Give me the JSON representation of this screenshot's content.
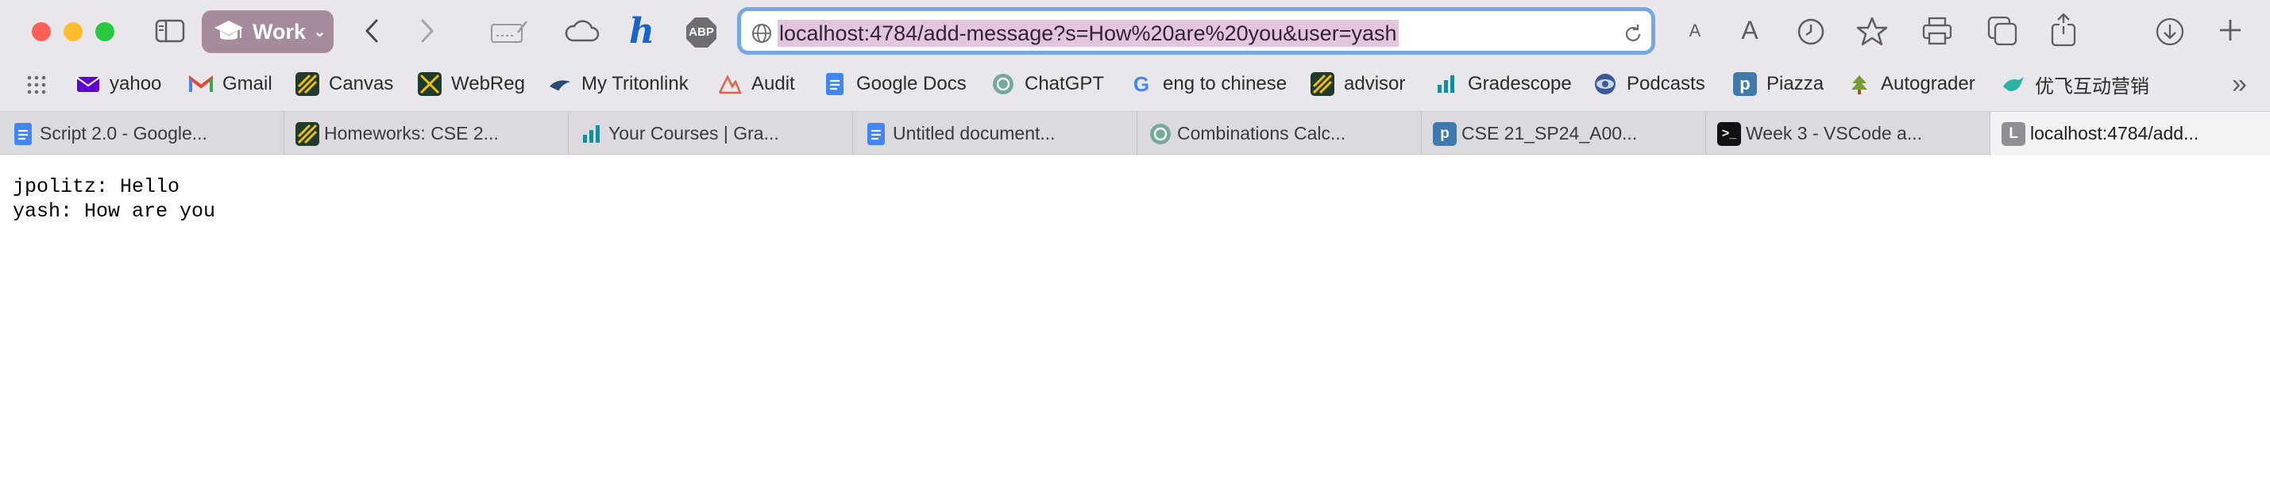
{
  "window": {
    "traffic_lights": {
      "close": "#fe5f57",
      "minimize": "#febc2e",
      "zoom": "#28c840"
    }
  },
  "toolbar": {
    "profile_label": "Work",
    "profile_color": "#a58b9b",
    "extensions": [
      "sidebar-icon",
      "back-icon",
      "forward-icon",
      "signature-icon",
      "cloud-icon",
      "honey-icon",
      "abp-icon"
    ],
    "abp_label": "ABP",
    "honey_label": "h",
    "url": "localhost:4784/add-message?s=How%20are%20you&user=yash",
    "right_icons": [
      "text-smaller-icon",
      "text-larger-icon",
      "history-icon",
      "bookmark-star-icon",
      "print-icon",
      "tabs-overview-icon",
      "share-icon",
      "downloads-icon",
      "new-tab-icon"
    ],
    "text_small": "A",
    "text_large": "A"
  },
  "bookmarks": [
    {
      "label": "yahoo",
      "icon": "yahoo-mail-icon",
      "color": "#6001d2"
    },
    {
      "label": "Gmail",
      "icon": "gmail-icon",
      "color": "#ea4335"
    },
    {
      "label": "Canvas",
      "icon": "canvas-icon",
      "color": "#1f3b2d"
    },
    {
      "label": "WebReg",
      "icon": "webreg-icon",
      "color": "#1f3b2d"
    },
    {
      "label": "My Tritonlink",
      "icon": "tritonlink-icon",
      "color": "#2c4b7a"
    },
    {
      "label": "Audit",
      "icon": "audit-icon",
      "color": "#e4604a"
    },
    {
      "label": "Google Docs",
      "icon": "google-docs-icon",
      "color": "#4285f4"
    },
    {
      "label": "ChatGPT",
      "icon": "chatgpt-icon",
      "color": "#74aa9c"
    },
    {
      "label": "eng to chinese",
      "icon": "google-icon",
      "color": "#4285f4"
    },
    {
      "label": "advisor",
      "icon": "advisor-icon",
      "color": "#1f3b2d"
    },
    {
      "label": "Gradescope",
      "icon": "gradescope-icon",
      "color": "#1c8a9a"
    },
    {
      "label": "Podcasts",
      "icon": "podcasts-icon",
      "color": "#3b5998"
    },
    {
      "label": "Piazza",
      "icon": "piazza-icon",
      "color": "#3e7aab"
    },
    {
      "label": "Autograder",
      "icon": "autograder-icon",
      "color": "#7a9a3a"
    },
    {
      "label": "优飞互动营销",
      "icon": "bird-icon",
      "color": "#2bb3a3"
    }
  ],
  "bookmarks_overflow": "»",
  "tabs": [
    {
      "label": "Script 2.0 - Google...",
      "icon": "google-docs-icon",
      "color": "#4285f4"
    },
    {
      "label": "Homeworks: CSE 2...",
      "icon": "canvas-icon",
      "color": "#1f3b2d"
    },
    {
      "label": "Your Courses | Gra...",
      "icon": "gradescope-icon",
      "color": "#1c8a9a"
    },
    {
      "label": "Untitled document...",
      "icon": "google-docs-icon",
      "color": "#4285f4"
    },
    {
      "label": "Combinations Calc...",
      "icon": "chatgpt-icon",
      "color": "#74aa9c"
    },
    {
      "label": "CSE 21_SP24_A00...",
      "icon": "piazza-icon",
      "color": "#3e7aab"
    },
    {
      "label": "Week 3 - VSCode a...",
      "icon": "terminal-icon",
      "color": "#111111"
    },
    {
      "label": "localhost:4784/add...",
      "icon": "letter-l-icon",
      "color": "#8e8e93",
      "active": true,
      "letter": "L"
    }
  ],
  "page": {
    "messages": [
      {
        "user": "jpolitz",
        "text": "Hello"
      },
      {
        "user": "yash",
        "text": "How are you"
      }
    ],
    "line1": "jpolitz: Hello",
    "line2": "yash: How are you"
  }
}
